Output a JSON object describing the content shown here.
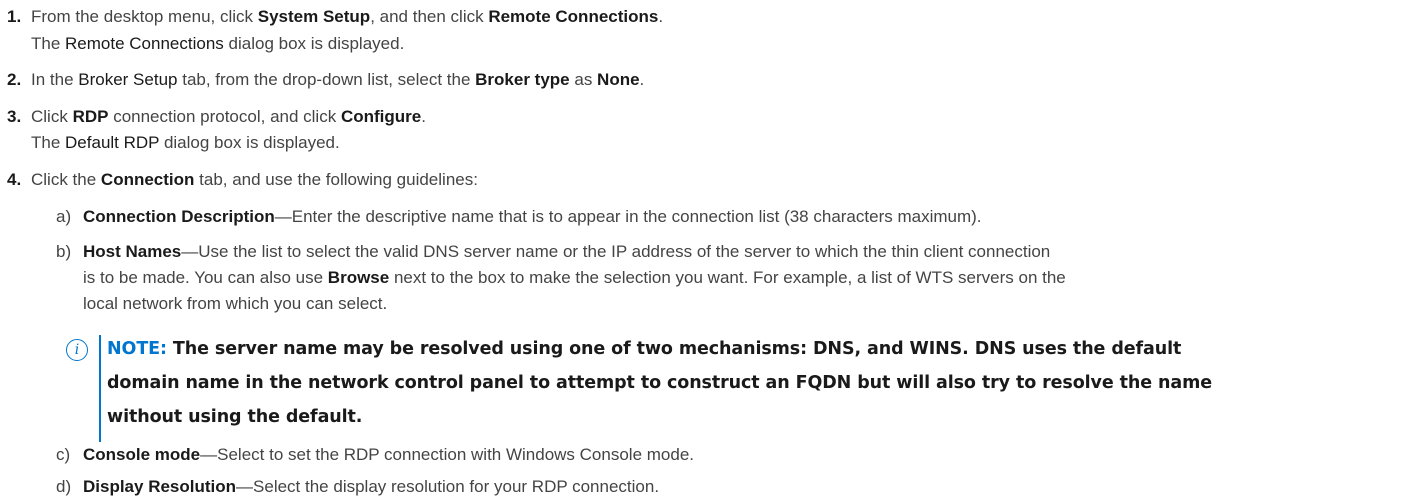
{
  "steps": [
    {
      "number": "1.",
      "pre": "From the desktop menu, click ",
      "b1": "System Setup",
      "mid": ", and then click ",
      "b2": "Remote Connections",
      "post": ".",
      "result_pre": "The ",
      "result_ui": "Remote Connections",
      "result_post": " dialog box is displayed."
    },
    {
      "number": "2.",
      "pre": "In the ",
      "ui1": "Broker Setup",
      "mid1": " tab, from the drop-down list, select the ",
      "b1": "Broker type",
      "mid2": " as ",
      "b2": "None",
      "post": "."
    },
    {
      "number": "3.",
      "pre": "Click ",
      "b1": "RDP",
      "mid": " connection protocol, and click ",
      "b2": "Configure",
      "post": ".",
      "result_pre": "The ",
      "result_ui": "Default RDP",
      "result_post": " dialog box is displayed."
    },
    {
      "number": "4.",
      "pre": "Click the ",
      "b1": "Connection",
      "post": " tab, and use the following guidelines:"
    }
  ],
  "substeps": [
    {
      "letter": "a)",
      "term": "Connection Description",
      "text": "—Enter the descriptive name that is to appear in the connection list (38 characters maximum)."
    },
    {
      "letter": "b)",
      "term": "Host Names",
      "text": "—Use the list to select the valid DNS server name or the IP address of the server to which the thin client connection",
      "line2": "is to be made. You can also use ",
      "line2_b": "Browse",
      "line2_post": " next to the box to make the selection you want. For example, a list of WTS servers on the",
      "line3": "local network from which you can select."
    },
    {
      "letter": "c)",
      "term": "Console mode",
      "text": "—Select to set the RDP connection with Windows Console mode."
    },
    {
      "letter": "d)",
      "term": "Display Resolution",
      "text": "—Select the display resolution for your RDP connection."
    }
  ],
  "note": {
    "icon": "info-icon",
    "icon_glyph": "i",
    "label": "NOTE:",
    "line1": " The server name may be resolved using one of two mechanisms: DNS, and WINS. DNS uses the default",
    "line2": "domain name in the network control panel to attempt to construct an FQDN but will also try to resolve the name",
    "line3": "without using the default.",
    "accent_color": "#0076ce"
  }
}
